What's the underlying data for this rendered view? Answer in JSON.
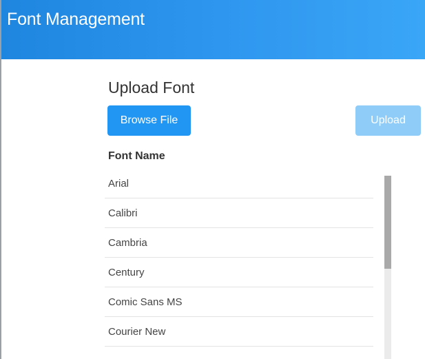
{
  "header": {
    "title": "Font Management"
  },
  "upload": {
    "title": "Upload Font",
    "browse_label": "Browse File",
    "upload_label": "Upload"
  },
  "table": {
    "column_header": "Font Name",
    "rows": [
      "Arial",
      "Calibri",
      "Cambria",
      "Century",
      "Comic Sans MS",
      "Courier New"
    ]
  },
  "colors": {
    "accent": "#2196f3",
    "accent_disabled": "#8fcdf8",
    "header_gradient_start": "#1f86e0",
    "header_gradient_end": "#3aa6f6"
  },
  "scroll": {
    "position_fraction": 0
  }
}
